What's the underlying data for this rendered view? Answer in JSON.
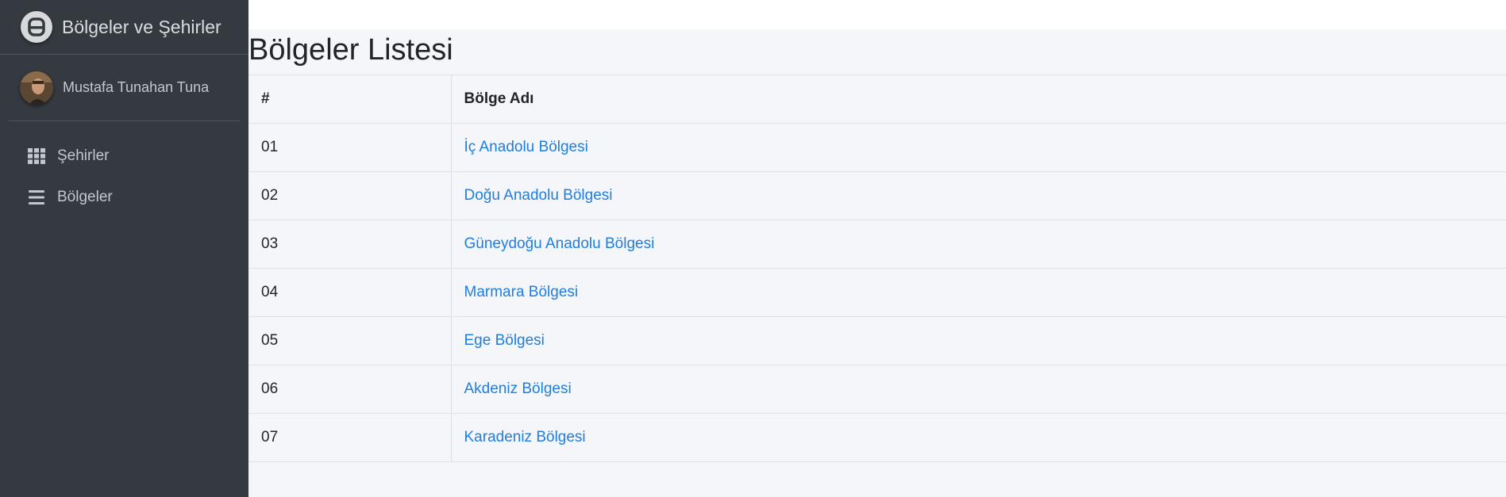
{
  "brand": {
    "logo_icon": "app-logo-icon",
    "title": "Bölgeler ve Şehirler"
  },
  "user": {
    "name": "Mustafa Tunahan Tuna",
    "avatar_icon": "user-avatar"
  },
  "nav": [
    {
      "icon": "grid-icon",
      "label": "Şehirler"
    },
    {
      "icon": "list-icon",
      "label": "Bölgeler"
    }
  ],
  "page": {
    "title": "Bölgeler Listesi"
  },
  "table": {
    "headers": {
      "num": "#",
      "name": "Bölge Adı"
    },
    "rows": [
      {
        "num": "01",
        "name": "İç Anadolu Bölgesi"
      },
      {
        "num": "02",
        "name": "Doğu Anadolu Bölgesi"
      },
      {
        "num": "03",
        "name": "Güneydoğu Anadolu Bölgesi"
      },
      {
        "num": "04",
        "name": "Marmara Bölgesi"
      },
      {
        "num": "05",
        "name": "Ege Bölgesi"
      },
      {
        "num": "06",
        "name": "Akdeniz Bölgesi"
      },
      {
        "num": "07",
        "name": "Karadeniz Bölgesi"
      }
    ]
  },
  "colors": {
    "sidebar": "#343a40",
    "link": "#1f7ee0",
    "background": "#f4f6f9"
  }
}
